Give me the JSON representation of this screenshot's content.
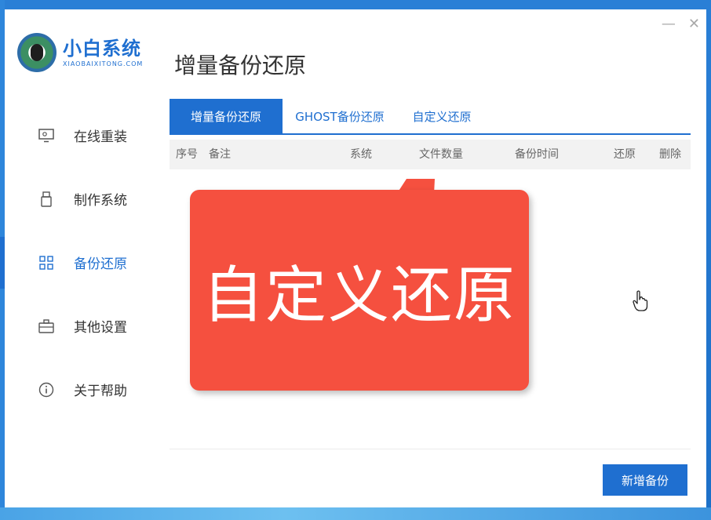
{
  "window": {
    "minimize_glyph": "—",
    "close_glyph": "✕"
  },
  "logo": {
    "title": "小白系统",
    "subtitle": "XIAOBAIXITONG.COM"
  },
  "sidebar": {
    "items": [
      {
        "label": "在线重装",
        "icon": "monitor-icon"
      },
      {
        "label": "制作系统",
        "icon": "usb-icon"
      },
      {
        "label": "备份还原",
        "icon": "grid-icon"
      },
      {
        "label": "其他设置",
        "icon": "briefcase-icon"
      },
      {
        "label": "关于帮助",
        "icon": "info-icon"
      }
    ],
    "active_index": 2
  },
  "main": {
    "title": "增量备份还原",
    "tabs": [
      {
        "label": "增量备份还原"
      },
      {
        "label": "GHOST备份还原"
      },
      {
        "label": "自定义还原"
      }
    ],
    "columns": [
      "序号",
      "备注",
      "系统",
      "文件数量",
      "备份时间",
      "还原",
      "删除"
    ],
    "add_button": "新增备份"
  },
  "callout": {
    "text": "自定义还原"
  },
  "colors": {
    "accent": "#1f6fd0",
    "callout": "#f5503f"
  }
}
